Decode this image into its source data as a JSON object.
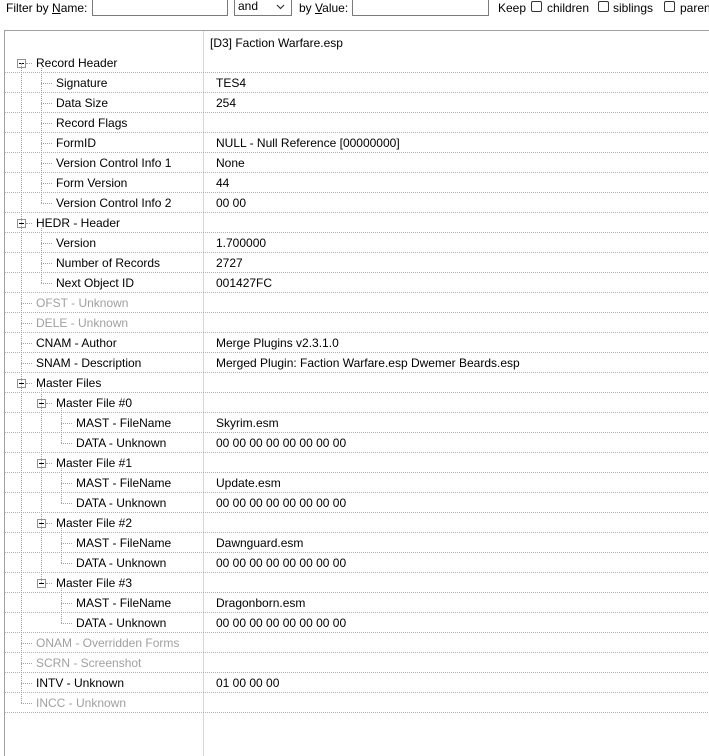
{
  "filter": {
    "name_label_prefix": "Filter by ",
    "name_label_key": "N",
    "name_label_suffix": "ame:",
    "name_value": "",
    "operator": "and",
    "value_label_prefix": "by ",
    "value_label_key": "V",
    "value_label_suffix": "alue:",
    "value_value": "",
    "keep_label": "Keep",
    "children_label": "children",
    "siblings_label": "siblings",
    "parents_label": "paren"
  },
  "header": {
    "file": "[D3] Faction Warfare.esp"
  },
  "rows": [
    {
      "name": "Record Header",
      "value": "",
      "level": 0,
      "expandable": true
    },
    {
      "name": "Signature",
      "value": "TES4",
      "level": 1
    },
    {
      "name": "Data Size",
      "value": "254",
      "level": 1
    },
    {
      "name": "Record Flags",
      "value": "",
      "level": 1
    },
    {
      "name": "FormID",
      "value": "NULL - Null Reference [00000000]",
      "level": 1
    },
    {
      "name": "Version Control Info 1",
      "value": "None",
      "level": 1
    },
    {
      "name": "Form Version",
      "value": "44",
      "level": 1
    },
    {
      "name": "Version Control Info 2",
      "value": "00 00",
      "level": 1
    },
    {
      "name": "HEDR - Header",
      "value": "",
      "level": 0,
      "expandable": true
    },
    {
      "name": "Version",
      "value": "1.700000",
      "level": 1
    },
    {
      "name": "Number of Records",
      "value": "2727",
      "level": 1
    },
    {
      "name": "Next Object ID",
      "value": "001427FC",
      "level": 1
    },
    {
      "name": "OFST - Unknown",
      "value": "",
      "level": 0,
      "gray": true
    },
    {
      "name": "DELE - Unknown",
      "value": "",
      "level": 0,
      "gray": true
    },
    {
      "name": "CNAM - Author",
      "value": "Merge Plugins v2.3.1.0",
      "level": 0
    },
    {
      "name": "SNAM - Description",
      "value": "Merged Plugin:   Faction Warfare.esp  Dwemer Beards.esp",
      "level": 0
    },
    {
      "name": "Master Files",
      "value": "",
      "level": 0,
      "expandable": true
    },
    {
      "name": "Master File #0",
      "value": "",
      "level": 1,
      "expandable": true
    },
    {
      "name": "MAST - FileName",
      "value": "Skyrim.esm",
      "level": 2
    },
    {
      "name": "DATA - Unknown",
      "value": "00 00 00 00 00 00 00 00",
      "level": 2
    },
    {
      "name": "Master File #1",
      "value": "",
      "level": 1,
      "expandable": true
    },
    {
      "name": "MAST - FileName",
      "value": "Update.esm",
      "level": 2
    },
    {
      "name": "DATA - Unknown",
      "value": "00 00 00 00 00 00 00 00",
      "level": 2
    },
    {
      "name": "Master File #2",
      "value": "",
      "level": 1,
      "expandable": true
    },
    {
      "name": "MAST - FileName",
      "value": "Dawnguard.esm",
      "level": 2
    },
    {
      "name": "DATA - Unknown",
      "value": "00 00 00 00 00 00 00 00",
      "level": 2
    },
    {
      "name": "Master File #3",
      "value": "",
      "level": 1,
      "expandable": true
    },
    {
      "name": "MAST - FileName",
      "value": "Dragonborn.esm",
      "level": 2
    },
    {
      "name": "DATA - Unknown",
      "value": "00 00 00 00 00 00 00 00",
      "level": 2
    },
    {
      "name": "ONAM - Overridden Forms",
      "value": "",
      "level": 0,
      "gray": true
    },
    {
      "name": "SCRN - Screenshot",
      "value": "",
      "level": 0,
      "gray": true
    },
    {
      "name": "INTV - Unknown",
      "value": "01 00 00 00",
      "level": 0
    },
    {
      "name": "INCC - Unknown",
      "value": "",
      "level": 0,
      "gray": true
    }
  ]
}
